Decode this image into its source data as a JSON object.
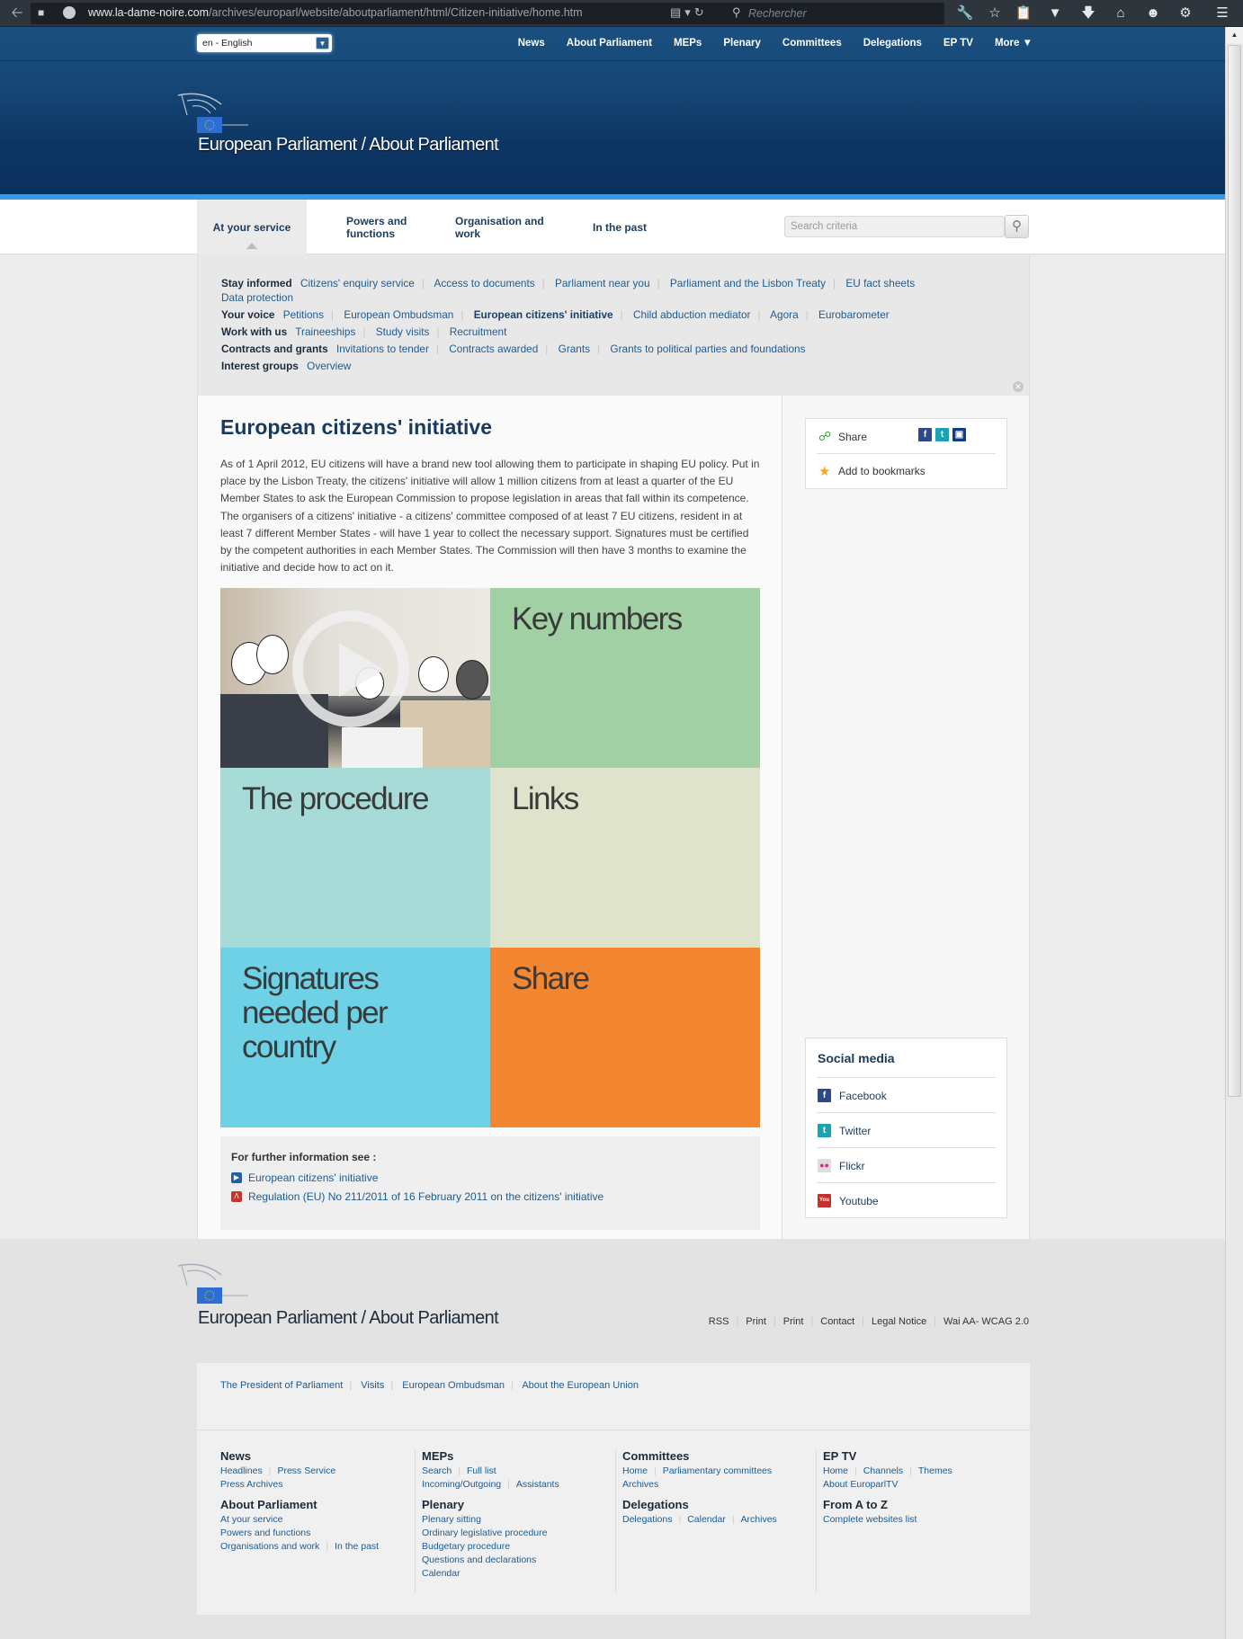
{
  "browser": {
    "url_domain": "www.la-dame-noire.com",
    "url_path": "/archives/europarl/website/aboutparliament/html/Citizen-initiative/home.htm",
    "search_placeholder": "Rechercher"
  },
  "header": {
    "language": "en - English",
    "nav": [
      "News",
      "About Parliament",
      "MEPs",
      "Plenary",
      "Committees",
      "Delegations",
      "EP TV",
      "More ▼"
    ],
    "site_title": "European Parliament / About Parliament"
  },
  "tabs": [
    {
      "label": "At your service",
      "active": true
    },
    {
      "label": "Powers and functions",
      "active": false
    },
    {
      "label": "Organisation and work",
      "active": false
    },
    {
      "label": "In the past",
      "active": false
    }
  ],
  "search": {
    "placeholder": "Search criteria"
  },
  "submenu": {
    "stay_informed": {
      "label": "Stay informed",
      "links": [
        "Citizens' enquiry service",
        "Access to documents",
        "Parliament near you",
        "Parliament and the Lisbon Treaty",
        "EU fact sheets"
      ],
      "wrap": "Data protection"
    },
    "your_voice": {
      "label": "Your voice",
      "links": [
        "Petitions",
        "European Ombudsman",
        "European citizens' initiative",
        "Child abduction mediator",
        "Agora",
        "Eurobarometer"
      ],
      "current": "European citizens' initiative"
    },
    "work_with_us": {
      "label": "Work with us",
      "links": [
        "Traineeships",
        "Study visits",
        "Recruitment"
      ]
    },
    "contracts": {
      "label": "Contracts and grants",
      "links": [
        "Invitations to tender",
        "Contracts awarded",
        "Grants",
        "Grants to political parties and foundations"
      ]
    },
    "interest": {
      "label": "Interest groups",
      "links": [
        "Overview"
      ]
    }
  },
  "main": {
    "title": "European citizens' initiative",
    "intro": "As of 1 April 2012, EU citizens will have a brand new tool allowing them to participate in shaping EU policy. Put in place by the Lisbon Treaty, the citizens' initiative will allow 1 million citizens from at least a quarter of the EU Member States to ask the European Commission to propose legislation in areas that fall within its competence. The organisers of a citizens' initiative - a citizens' committee composed of at least 7 EU citizens, resident in at least 7 different Member States - will have 1 year to collect the necessary support. Signatures must be certified by the competent authorities in each Member States. The Commission will then have 3 months to examine the initiative and decide how to act on it.",
    "tiles": [
      {
        "label": "Key numbers",
        "color": "#a1d0a5"
      },
      {
        "label": "The procedure",
        "color": "#a6dbd7"
      },
      {
        "label": "Links",
        "color": "#e0e3cc"
      },
      {
        "label": "Signatures needed per country",
        "color": "#6fd1e5"
      },
      {
        "label": "Share",
        "color": "#f28631"
      }
    ],
    "further": {
      "heading": "For further information see :",
      "links": [
        "European citizens' initiative",
        "Regulation (EU) No 211/2011 of 16 February 2011 on the citizens' initiative"
      ]
    }
  },
  "sidebar": {
    "share_label": "Share",
    "bookmark_label": "Add to bookmarks",
    "social_title": "Social media",
    "social": [
      "Facebook",
      "Twitter",
      "Flickr",
      "Youtube"
    ]
  },
  "footer": {
    "site_title": "European Parliament / About Parliament",
    "utility_links": [
      "RSS",
      "Print",
      "Print",
      "Contact",
      "Legal Notice",
      "Wai AA- WCAG 2.0"
    ],
    "top_links": [
      "The President of Parliament",
      "Visits",
      "European Ombudsman",
      "About the European Union"
    ],
    "columns": [
      [
        {
          "title": "News",
          "rows": [
            [
              "Headlines",
              "Press Service"
            ],
            [
              "Press Archives"
            ]
          ]
        },
        {
          "title": "About Parliament",
          "rows": [
            [
              "At your service"
            ],
            [
              "Powers and functions"
            ],
            [
              "Organisations and work",
              "In the past"
            ]
          ]
        }
      ],
      [
        {
          "title": "MEPs",
          "rows": [
            [
              "Search",
              "Full list"
            ],
            [
              "Incoming/Outgoing",
              "Assistants"
            ]
          ]
        },
        {
          "title": "Plenary",
          "rows": [
            [
              "Plenary sitting"
            ],
            [
              "Ordinary legislative procedure"
            ],
            [
              "Budgetary procedure"
            ],
            [
              "Questions and declarations"
            ],
            [
              "Calendar"
            ]
          ]
        }
      ],
      [
        {
          "title": "Committees",
          "rows": [
            [
              "Home",
              "Parliamentary committees"
            ],
            [
              "Archives"
            ]
          ]
        },
        {
          "title": "Delegations",
          "rows": [
            [
              "Delegations",
              "Calendar",
              "Archives"
            ]
          ]
        }
      ],
      [
        {
          "title": "EP TV",
          "rows": [
            [
              "Home",
              "Channels",
              "Themes"
            ],
            [
              "About EuroparlTV"
            ]
          ]
        },
        {
          "title": "From A to Z",
          "rows": [
            [
              "Complete websites list"
            ]
          ]
        }
      ]
    ]
  }
}
